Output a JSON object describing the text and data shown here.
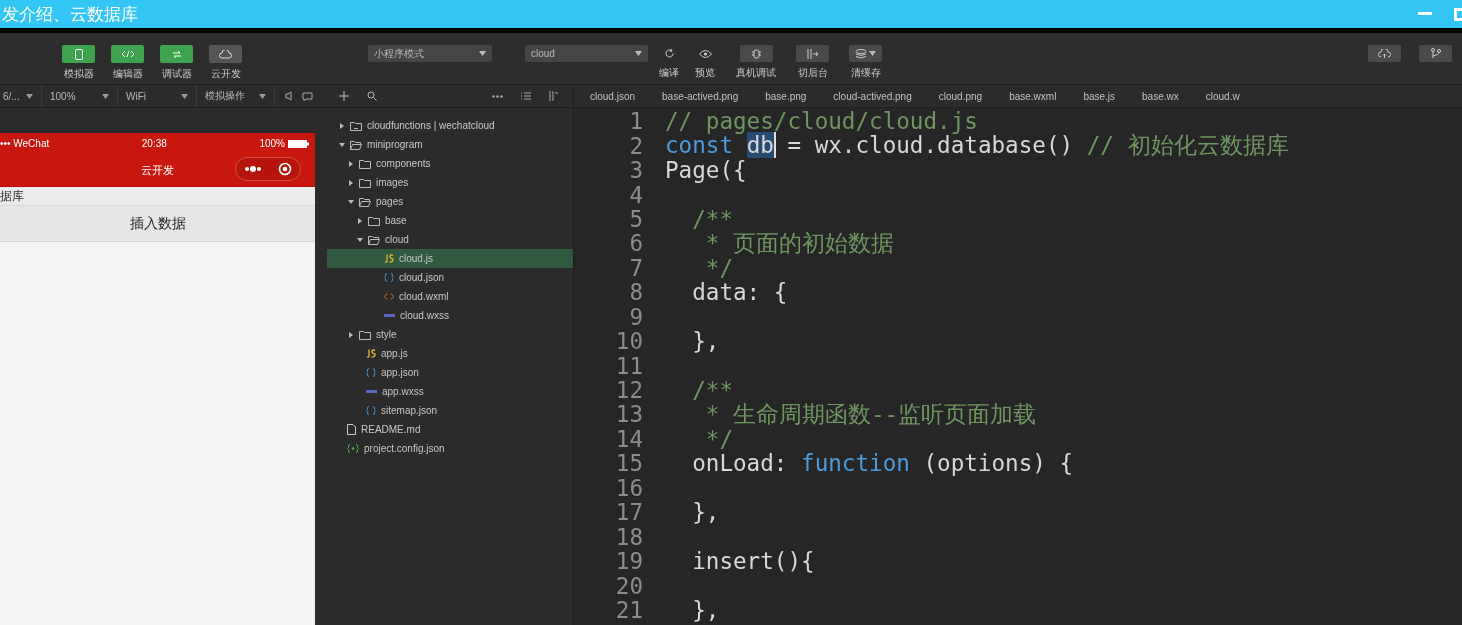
{
  "window": {
    "title": "发介绍、云数据库"
  },
  "toolbar": {
    "view_buttons": [
      {
        "label": "模拟器",
        "on": true
      },
      {
        "label": "编辑器",
        "on": true
      },
      {
        "label": "调试器",
        "on": true
      },
      {
        "label": "云开发",
        "on": false
      }
    ],
    "mode_dropdown": "小程序模式",
    "compile_dropdown": "cloud",
    "actions": [
      {
        "label": "编译"
      },
      {
        "label": "预览"
      },
      {
        "label": "真机调试"
      },
      {
        "label": "切后台"
      },
      {
        "label": "清缓存"
      }
    ]
  },
  "simulator_bar": {
    "device": "6/...",
    "zoom": "100%",
    "network": "WiFi",
    "operation": "模拟操作"
  },
  "editor_tabs": [
    {
      "label": "cloud.json"
    },
    {
      "label": "base-actived.png"
    },
    {
      "label": "base.png"
    },
    {
      "label": "cloud-actived.png"
    },
    {
      "label": "cloud.png"
    },
    {
      "label": "base.wxml"
    },
    {
      "label": "base.js"
    },
    {
      "label": "base.wx"
    },
    {
      "label": "cloud.w"
    }
  ],
  "phone": {
    "carrier": "••• WeChat",
    "time": "20:38",
    "battery": "100%",
    "nav_title": "云开发",
    "section_label": "据库",
    "insert_button": "插入数据"
  },
  "file_tree": [
    {
      "name": "cloudfunctions | wechatcloud",
      "kind": "cloudfolder",
      "expanded": false,
      "selected": false
    },
    {
      "name": "miniprogram",
      "kind": "folder",
      "expanded": true,
      "selected": false,
      "children": [
        {
          "name": "components",
          "kind": "folder",
          "expanded": false,
          "selected": false
        },
        {
          "name": "images",
          "kind": "folder",
          "expanded": false,
          "selected": false
        },
        {
          "name": "pages",
          "kind": "folder",
          "expanded": true,
          "selected": false,
          "children": [
            {
              "name": "base",
              "kind": "folder",
              "expanded": false,
              "selected": false
            },
            {
              "name": "cloud",
              "kind": "folder",
              "expanded": true,
              "selected": false,
              "children": [
                {
                  "name": "cloud.js",
                  "kind": "js",
                  "selected": true
                },
                {
                  "name": "cloud.json",
                  "kind": "json",
                  "selected": false
                },
                {
                  "name": "cloud.wxml",
                  "kind": "wxml",
                  "selected": false
                },
                {
                  "name": "cloud.wxss",
                  "kind": "wxss",
                  "selected": false
                }
              ]
            }
          ]
        },
        {
          "name": "style",
          "kind": "folder",
          "expanded": false,
          "selected": false
        },
        {
          "name": "app.js",
          "kind": "js",
          "selected": false
        },
        {
          "name": "app.json",
          "kind": "json",
          "selected": false
        },
        {
          "name": "app.wxss",
          "kind": "wxss",
          "selected": false
        },
        {
          "name": "sitemap.json",
          "kind": "json",
          "selected": false
        }
      ]
    },
    {
      "name": "README.md",
      "kind": "file",
      "selected": false
    },
    {
      "name": "project.config.json",
      "kind": "config",
      "selected": false
    }
  ],
  "code_lines": [
    {
      "number": "1",
      "tokens": [
        {
          "kind": "comment",
          "text": "// pages/cloud/cloud.js"
        }
      ]
    },
    {
      "number": "2",
      "tokens": [
        {
          "kind": "keyword",
          "text": "const "
        },
        {
          "kind": "selection",
          "text": "db"
        },
        {
          "kind": "plain",
          "text": " = wx.cloud.database() "
        },
        {
          "kind": "comment",
          "text": "// 初始化云数据库"
        }
      ]
    },
    {
      "number": "3",
      "tokens": [
        {
          "kind": "plain",
          "text": "Page({"
        }
      ]
    },
    {
      "number": "4"
    },
    {
      "number": "5",
      "tokens": [
        {
          "kind": "comment",
          "text": "  /**"
        }
      ]
    },
    {
      "number": "6",
      "tokens": [
        {
          "kind": "comment",
          "text": "   * 页面的初始数据"
        }
      ]
    },
    {
      "number": "7",
      "tokens": [
        {
          "kind": "comment",
          "text": "   */"
        }
      ]
    },
    {
      "number": "8",
      "tokens": [
        {
          "kind": "plain",
          "text": "  data: {"
        }
      ]
    },
    {
      "number": "9"
    },
    {
      "number": "10",
      "tokens": [
        {
          "kind": "plain",
          "text": "  },"
        }
      ]
    },
    {
      "number": "11"
    },
    {
      "number": "12",
      "tokens": [
        {
          "kind": "comment",
          "text": "  /**"
        }
      ]
    },
    {
      "number": "13",
      "tokens": [
        {
          "kind": "comment",
          "text": "   * 生命周期函数--监听页面加载"
        }
      ]
    },
    {
      "number": "14",
      "tokens": [
        {
          "kind": "comment",
          "text": "   */"
        }
      ]
    },
    {
      "number": "15",
      "tokens": [
        {
          "kind": "plain",
          "text": "  onLoad: "
        },
        {
          "kind": "keyword",
          "text": "function"
        },
        {
          "kind": "plain",
          "text": " (options) {"
        }
      ]
    },
    {
      "number": "16"
    },
    {
      "number": "17",
      "tokens": [
        {
          "kind": "plain",
          "text": "  },"
        }
      ]
    },
    {
      "number": "18"
    },
    {
      "number": "19",
      "tokens": [
        {
          "kind": "plain",
          "text": "  insert(){"
        }
      ]
    },
    {
      "number": "20"
    },
    {
      "number": "21",
      "tokens": [
        {
          "kind": "plain",
          "text": "  },"
        }
      ]
    }
  ]
}
